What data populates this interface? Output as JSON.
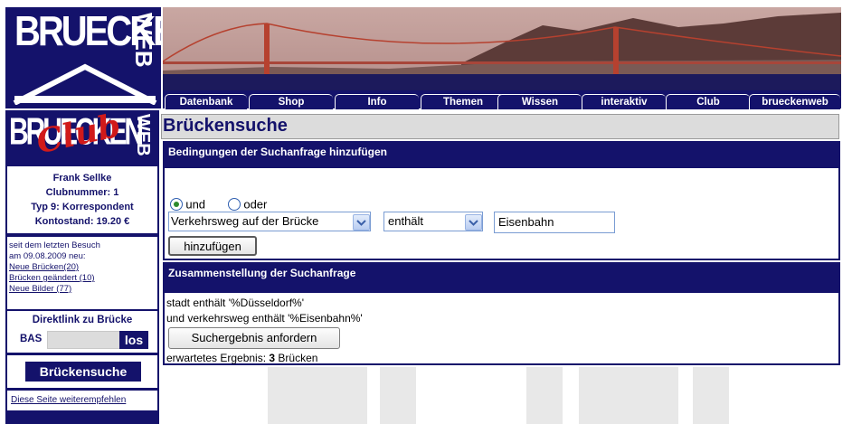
{
  "header": {
    "logo_text": "BRUECKEN",
    "logo_web": "WEB",
    "nav": [
      "Datenbank",
      "Shop",
      "Info",
      "Themen",
      "Wissen",
      "interaktiv",
      "Club",
      "brueckenweb"
    ]
  },
  "sidebar": {
    "club_logo_text": "BRUECKEN",
    "club_script": "Club",
    "club_web": "WEB",
    "member_name": "Frank Sellke",
    "club_number": "Clubnummer: 1",
    "member_type": "Typ 9: Korrespondent",
    "balance": "Kontostand: 19.20 €",
    "visit_line1": "seit dem letzten Besuch",
    "visit_line2": "am 09.08.2009 neu:",
    "links": [
      "Neue Brücken(20)",
      "Brücken geändert (10)",
      "Neue Bilder (77)"
    ],
    "direct_title": "Direktlink zu Brücke",
    "direct_prefix": "BAS",
    "direct_go": "los",
    "search_button": "Brückensuche",
    "recommend": "Diese Seite weiterempfehlen"
  },
  "main": {
    "title": "Brückensuche",
    "conditions_header": "Bedingungen der Suchanfrage hinzufügen",
    "radio_and": "und",
    "radio_or": "oder",
    "field_select": "Verkehrsweg auf der Brücke",
    "operator_select": "enthält",
    "value_input": "Eisenbahn",
    "add_button": "hinzufügen",
    "summary_header": "Zusammenstellung der Suchanfrage",
    "query_line1": "stadt enthält '%Düsseldorf%'",
    "query_line2": "und verkehrsweg enthält '%Eisenbahn%'",
    "request_button": "Suchergebnis anfordern",
    "expected_prefix": "erwartetes Ergebnis: ",
    "expected_count": "3",
    "expected_suffix": " Brücken"
  }
}
